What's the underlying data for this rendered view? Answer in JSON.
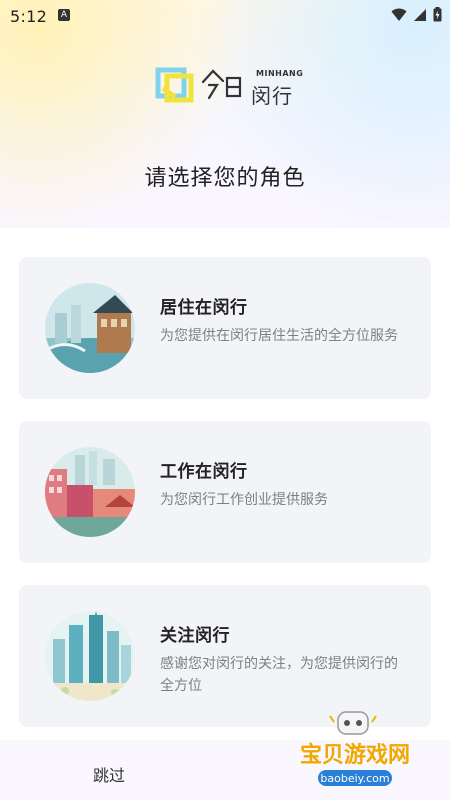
{
  "status": {
    "time": "5:12",
    "keyboard_icon": "A"
  },
  "logo": {
    "cn": "闵行",
    "en": "MINHANG"
  },
  "title": "请选择您的角色",
  "roles": [
    {
      "title": "居住在闵行",
      "description": "为您提供在闵行居住生活的全方位服务",
      "icon": "residence-illustration"
    },
    {
      "title": "工作在闵行",
      "description": "为您闵行工作创业提供服务",
      "icon": "work-illustration"
    },
    {
      "title": "关注闵行",
      "description": "感谢您对闵行的关注，为您提供闵行的全方位",
      "icon": "follow-illustration"
    }
  ],
  "bottom": {
    "skip": "跳过"
  },
  "watermark": {
    "cn": "宝贝游戏网",
    "url": "baobeiy.com"
  },
  "colors": {
    "card_bg": "#f3f4f7",
    "desc": "#7d7f86",
    "title": "#222222"
  }
}
